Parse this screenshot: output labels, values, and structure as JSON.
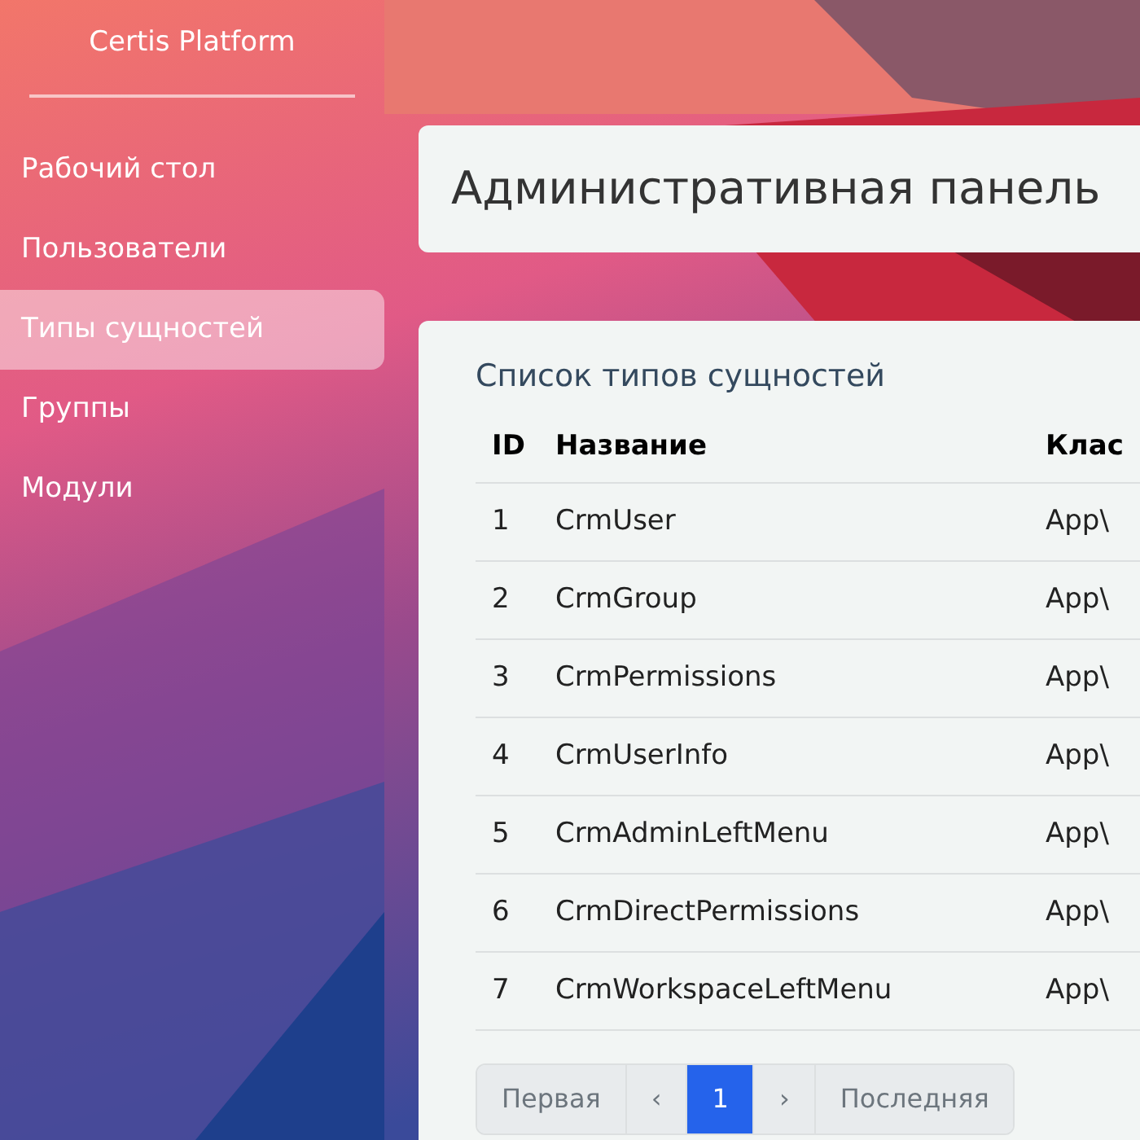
{
  "sidebar": {
    "brand": "Certis Platform",
    "items": [
      {
        "label": "Рабочий стол",
        "selected": false
      },
      {
        "label": "Пользователи",
        "selected": false
      },
      {
        "label": "Типы сущностей",
        "selected": true
      },
      {
        "label": "Группы",
        "selected": false
      },
      {
        "label": "Модули",
        "selected": false
      }
    ]
  },
  "header": {
    "title": "Административная панель"
  },
  "card": {
    "title": "Список типов сущностей",
    "table": {
      "columns": [
        "ID",
        "Название",
        "Клас"
      ],
      "rows": [
        [
          "1",
          "CrmUser",
          "App\\"
        ],
        [
          "2",
          "CrmGroup",
          "App\\"
        ],
        [
          "3",
          "CrmPermissions",
          "App\\"
        ],
        [
          "4",
          "CrmUserInfo",
          "App\\"
        ],
        [
          "5",
          "CrmAdminLeftMenu",
          "App\\"
        ],
        [
          "6",
          "CrmDirectPermissions",
          "App\\"
        ],
        [
          "7",
          "CrmWorkspaceLeftMenu",
          "App\\"
        ]
      ]
    },
    "pagination": [
      {
        "label": "Первая",
        "selected": false
      },
      {
        "label": "‹",
        "selected": false
      },
      {
        "label": "1",
        "selected": true
      },
      {
        "label": "›",
        "selected": false
      },
      {
        "label": "Последняя",
        "selected": false
      }
    ]
  }
}
